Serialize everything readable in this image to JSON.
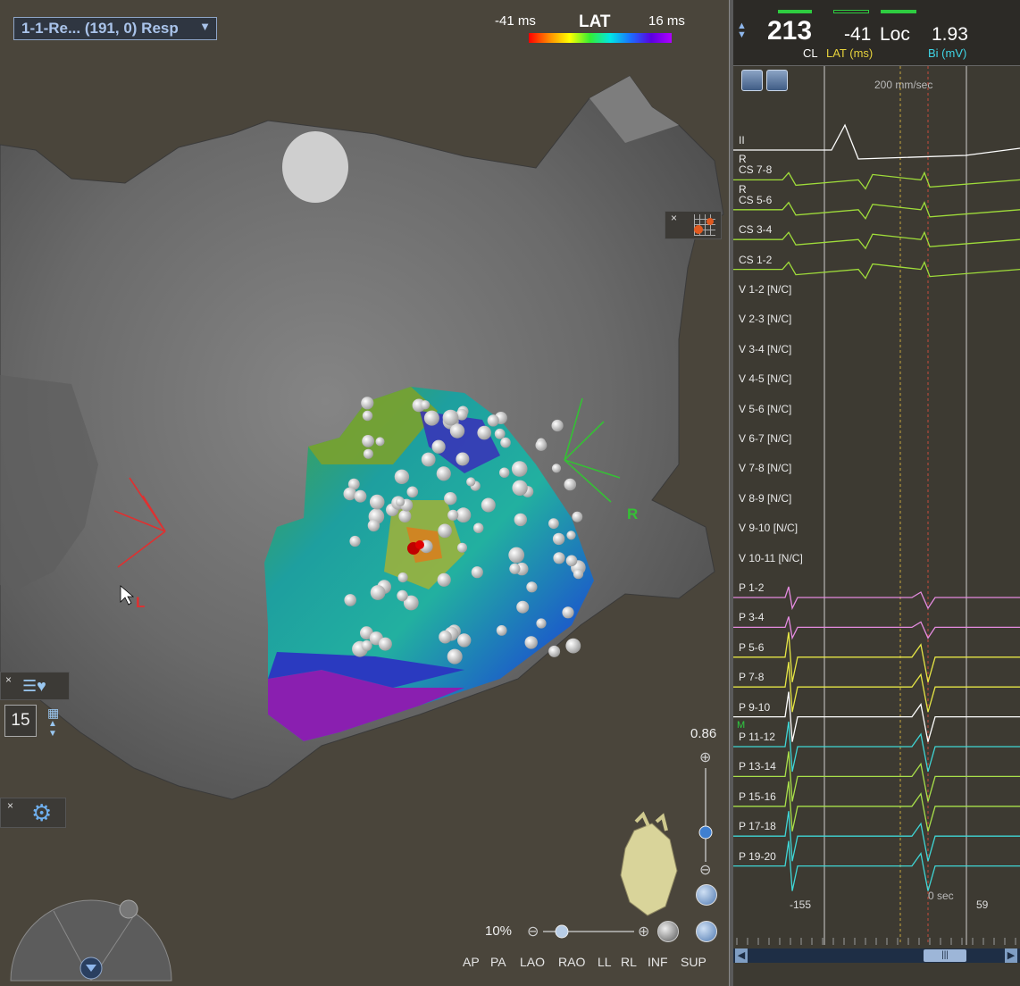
{
  "map": {
    "selector": "1-1-Re... (191, 0) Resp",
    "lat_min": "-41 ms",
    "lat_title": "LAT",
    "lat_max": "16 ms",
    "left_marker": "L",
    "right_marker": "R"
  },
  "tools": {
    "count_value": "15",
    "close": "×"
  },
  "zoom": {
    "value": "0.86",
    "percent": "10%"
  },
  "views": [
    "AP",
    "PA",
    "LAO",
    "RAO",
    "LL",
    "RL",
    "INF",
    "SUP"
  ],
  "header": {
    "cl_value": "213",
    "cl_label": "CL",
    "lat_value": "-41",
    "loc_label": "Loc",
    "lat_unit": "LAT (ms)",
    "bi_value": "1.93",
    "bi_unit": "Bi (mV)"
  },
  "egm": {
    "speed": "200 mm/sec",
    "channels": [
      "II",
      "CS 7-8",
      "CS 5-6",
      "CS 3-4",
      "CS 1-2",
      "V 1-2 [N/C]",
      "V 2-3 [N/C]",
      "V 3-4 [N/C]",
      "V 4-5 [N/C]",
      "V 5-6 [N/C]",
      "V 6-7 [N/C]",
      "V 7-8 [N/C]",
      "V 8-9 [N/C]",
      "V 9-10 [N/C]",
      "V 10-11 [N/C]",
      "P 1-2",
      "P 3-4",
      "P 5-6",
      "P 7-8",
      "P 9-10",
      "P 11-12",
      "P 13-14",
      "P 15-16",
      "P 17-18",
      "P 19-20"
    ],
    "ref_marks": [
      "R",
      "R"
    ],
    "m_mark": "M",
    "time_left": "-155",
    "time_zero": "0 sec",
    "time_right": "59",
    "colors": {
      "ecg": "#ffffff",
      "cs": "#9fdc3a",
      "p_pink": "#e58be0",
      "p_yellow": "#e6e645",
      "p_cyan": "#3fd6d6",
      "p_green": "#a8e04a"
    }
  }
}
